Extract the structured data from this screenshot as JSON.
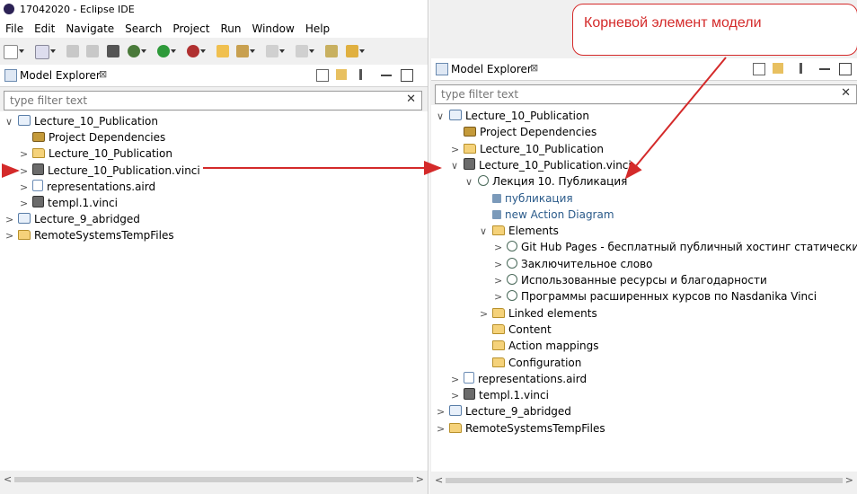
{
  "window": {
    "title": "17042020 - Eclipse IDE"
  },
  "menu": [
    "File",
    "Edit",
    "Navigate",
    "Search",
    "Project",
    "Run",
    "Window",
    "Help"
  ],
  "view": {
    "title": "Model Explorer",
    "close": "⊠"
  },
  "filter": {
    "placeholder": "type filter text"
  },
  "left_tree": [
    {
      "label": "Lecture_10_Publication",
      "icon": "project-icon",
      "chev": "∨",
      "indent": 0
    },
    {
      "label": "Project Dependencies",
      "icon": "dependencies-icon",
      "chev": "",
      "indent": 1
    },
    {
      "label": "Lecture_10_Publication",
      "icon": "folder-icon",
      "chev": ">",
      "indent": 1
    },
    {
      "label": "Lecture_10_Publication.vinci",
      "icon": "vinci-icon",
      "chev": ">",
      "indent": 1
    },
    {
      "label": "representations.aird",
      "icon": "aird-icon",
      "chev": ">",
      "indent": 1
    },
    {
      "label": "templ.1.vinci",
      "icon": "vinci-icon",
      "chev": ">",
      "indent": 1
    },
    {
      "label": "Lecture_9_abridged",
      "icon": "project-icon",
      "chev": ">",
      "indent": 0
    },
    {
      "label": "RemoteSystemsTempFiles",
      "icon": "folder-icon",
      "chev": ">",
      "indent": 0
    }
  ],
  "right_tree": [
    {
      "label": "Lecture_10_Publication",
      "icon": "project-icon",
      "chev": "∨",
      "indent": 0
    },
    {
      "label": "Project Dependencies",
      "icon": "dependencies-icon",
      "chev": "",
      "indent": 1
    },
    {
      "label": "Lecture_10_Publication",
      "icon": "folder-icon",
      "chev": ">",
      "indent": 1
    },
    {
      "label": "Lecture_10_Publication.vinci",
      "icon": "vinci-icon",
      "chev": "∨",
      "indent": 1
    },
    {
      "label": "Лекция  10. Публикация",
      "icon": "element-icon",
      "chev": "∨",
      "indent": 2
    },
    {
      "label": "публикация",
      "icon": "diagram-icon",
      "chev": "",
      "indent": 3,
      "link": true
    },
    {
      "label": "new Action Diagram",
      "icon": "diagram-icon",
      "chev": "",
      "indent": 3,
      "link": true
    },
    {
      "label": "Elements",
      "icon": "folder-icon",
      "chev": "∨",
      "indent": 3
    },
    {
      "label": "Git Hub Pages - бесплатный публичный хостинг статических сайт",
      "icon": "element-icon",
      "chev": ">",
      "indent": 4
    },
    {
      "label": "Заключительное слово",
      "icon": "element-icon",
      "chev": ">",
      "indent": 4
    },
    {
      "label": "Использованные ресурсы и благодарности",
      "icon": "element-icon",
      "chev": ">",
      "indent": 4
    },
    {
      "label": "Программы расширенных курсов по Nasdanika Vinci",
      "icon": "element-icon",
      "chev": ">",
      "indent": 4
    },
    {
      "label": "Linked elements",
      "icon": "folder-icon",
      "chev": ">",
      "indent": 3
    },
    {
      "label": "Content",
      "icon": "folder-icon",
      "chev": "",
      "indent": 3
    },
    {
      "label": "Action mappings",
      "icon": "folder-icon",
      "chev": "",
      "indent": 3
    },
    {
      "label": "Configuration",
      "icon": "folder-icon",
      "chev": "",
      "indent": 3
    },
    {
      "label": "representations.aird",
      "icon": "aird-icon",
      "chev": ">",
      "indent": 1
    },
    {
      "label": "templ.1.vinci",
      "icon": "vinci-icon",
      "chev": ">",
      "indent": 1
    },
    {
      "label": "Lecture_9_abridged",
      "icon": "project-icon",
      "chev": ">",
      "indent": 0
    },
    {
      "label": "RemoteSystemsTempFiles",
      "icon": "folder-icon",
      "chev": ">",
      "indent": 0
    }
  ],
  "callout": {
    "text": "Корневой элемент модели"
  },
  "colors": {
    "annotation_red": "#d42a2a",
    "link_blue": "#2a5a8a"
  }
}
